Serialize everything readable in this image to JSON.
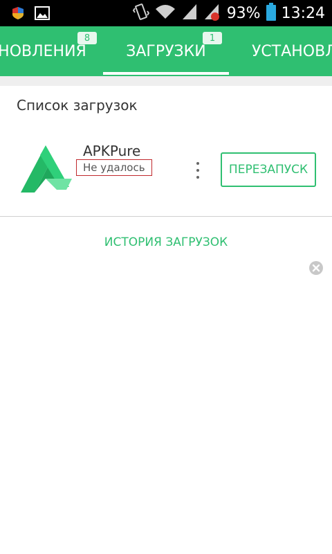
{
  "status_bar": {
    "battery_percent": "93%",
    "time": "13:24",
    "left_icons": [
      "shield-icon",
      "image-icon"
    ],
    "right_icons": [
      "vibrate-icon",
      "wifi-icon",
      "signal-icon",
      "signal-icon-2",
      "battery-icon"
    ]
  },
  "tabs": [
    {
      "label": "НОВЛЕНИЯ",
      "badge": "8"
    },
    {
      "label": "ЗАГРУЗКИ",
      "badge": "1"
    },
    {
      "label": "УСТАНОВЛ"
    }
  ],
  "main": {
    "section_title": "Список загрузок",
    "app": {
      "name": "APKPure",
      "status": "Не удалось",
      "action_label": "ПЕРЕЗАПУСК"
    },
    "history_label": "ИСТОРИЯ ЗАГРУЗОК"
  },
  "colors": {
    "accent": "#2fbf71",
    "status_highlight": "#c0282d"
  }
}
